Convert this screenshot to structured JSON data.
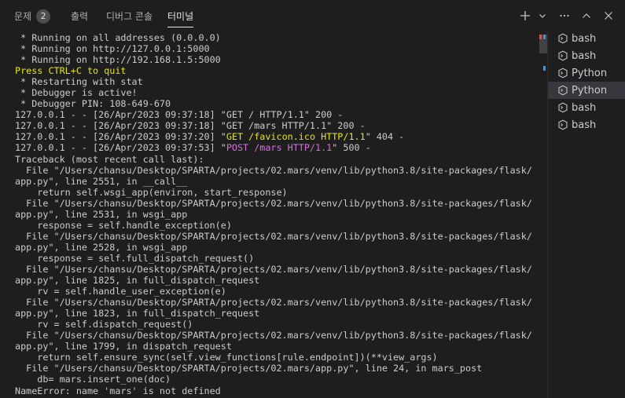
{
  "tabs": [
    {
      "label": "문제",
      "badge": "2"
    },
    {
      "label": "출력"
    },
    {
      "label": "디버그 콘솔"
    },
    {
      "label": "터미널",
      "active": true
    }
  ],
  "terminal": {
    "lines": [
      [
        {
          "t": " * Running on all addresses (0.0.0.0)"
        }
      ],
      [
        {
          "t": " * Running on http://127.0.0.1:5000"
        }
      ],
      [
        {
          "t": " * Running on http://192.168.1.5:5000"
        }
      ],
      [
        {
          "t": "Press CTRL+C to quit",
          "c": "yellow"
        }
      ],
      [
        {
          "t": " * Restarting with stat"
        }
      ],
      [
        {
          "t": " * Debugger is active!"
        }
      ],
      [
        {
          "t": " * Debugger PIN: 108-649-670"
        }
      ],
      [
        {
          "t": "127.0.0.1 - - [26/Apr/2023 09:37:18] \"GET / HTTP/1.1\" 200 -"
        }
      ],
      [
        {
          "t": "127.0.0.1 - - [26/Apr/2023 09:37:18] \"GET /mars HTTP/1.1\" 200 -"
        }
      ],
      [
        {
          "t": "127.0.0.1 - - [26/Apr/2023 09:37:20] \""
        },
        {
          "t": "GET /favicon.ico HTTP/1.1",
          "c": "yellow"
        },
        {
          "t": "\" 404 -"
        }
      ],
      [
        {
          "t": "127.0.0.1 - - [26/Apr/2023 09:37:53] \""
        },
        {
          "t": "POST /mars HTTP/1.1",
          "c": "magenta"
        },
        {
          "t": "\" 500 -"
        }
      ],
      [
        {
          "t": "Traceback (most recent call last):"
        }
      ],
      [
        {
          "t": "  File \"/Users/chansu/Desktop/SPARTA/projects/02.mars/venv/lib/python3.8/site-packages/flask/"
        }
      ],
      [
        {
          "t": "app.py\", line 2551, in __call__"
        }
      ],
      [
        {
          "t": "    return self.wsgi_app(environ, start_response)"
        }
      ],
      [
        {
          "t": "  File \"/Users/chansu/Desktop/SPARTA/projects/02.mars/venv/lib/python3.8/site-packages/flask/"
        }
      ],
      [
        {
          "t": "app.py\", line 2531, in wsgi_app"
        }
      ],
      [
        {
          "t": "    response = self.handle_exception(e)"
        }
      ],
      [
        {
          "t": "  File \"/Users/chansu/Desktop/SPARTA/projects/02.mars/venv/lib/python3.8/site-packages/flask/"
        }
      ],
      [
        {
          "t": "app.py\", line 2528, in wsgi_app"
        }
      ],
      [
        {
          "t": "    response = self.full_dispatch_request()"
        }
      ],
      [
        {
          "t": "  File \"/Users/chansu/Desktop/SPARTA/projects/02.mars/venv/lib/python3.8/site-packages/flask/"
        }
      ],
      [
        {
          "t": "app.py\", line 1825, in full_dispatch_request"
        }
      ],
      [
        {
          "t": "    rv = self.handle_user_exception(e)"
        }
      ],
      [
        {
          "t": "  File \"/Users/chansu/Desktop/SPARTA/projects/02.mars/venv/lib/python3.8/site-packages/flask/"
        }
      ],
      [
        {
          "t": "app.py\", line 1823, in full_dispatch_request"
        }
      ],
      [
        {
          "t": "    rv = self.dispatch_request()"
        }
      ],
      [
        {
          "t": "  File \"/Users/chansu/Desktop/SPARTA/projects/02.mars/venv/lib/python3.8/site-packages/flask/"
        }
      ],
      [
        {
          "t": "app.py\", line 1799, in dispatch_request"
        }
      ],
      [
        {
          "t": "    return self.ensure_sync(self.view_functions[rule.endpoint])(**view_args)"
        }
      ],
      [
        {
          "t": "  File \"/Users/chansu/Desktop/SPARTA/projects/02.mars/app.py\", line 24, in mars_post"
        }
      ],
      [
        {
          "t": "    db= mars.insert_one(doc)"
        }
      ],
      [
        {
          "t": "NameError: name 'mars' is not defined"
        }
      ]
    ]
  },
  "sessions": [
    {
      "label": "bash",
      "icon": "terminal-shell-icon"
    },
    {
      "label": "bash",
      "icon": "terminal-shell-icon"
    },
    {
      "label": "Python",
      "icon": "terminal-shell-icon"
    },
    {
      "label": "Python",
      "icon": "terminal-shell-icon",
      "selected": true
    },
    {
      "label": "bash",
      "icon": "terminal-shell-icon"
    },
    {
      "label": "bash",
      "icon": "terminal-shell-icon"
    }
  ],
  "toolbar_icons": [
    "plus-icon",
    "chevron-down-icon",
    "more-icon",
    "chevron-up-icon",
    "close-icon"
  ],
  "colors": {
    "background": "#1e1e1e",
    "text": "#cccccc",
    "ansi_yellow": "#e5e510",
    "ansi_magenta": "#d670d6",
    "selected_session": "#37373d",
    "minimap_red": "#f14c4c",
    "minimap_blue": "#3794ff"
  }
}
